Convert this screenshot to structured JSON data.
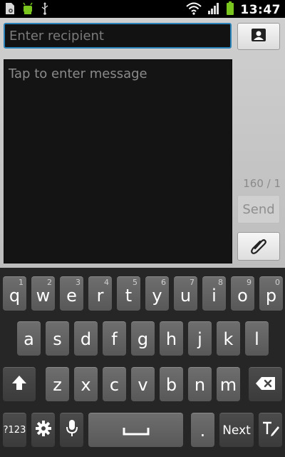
{
  "status_bar": {
    "time": "13:47",
    "left_icons": [
      "settings-file-icon",
      "android-icon",
      "usb-icon"
    ],
    "right_icons": [
      "wifi-icon",
      "signal-icon",
      "battery-icon"
    ]
  },
  "compose": {
    "recipient_placeholder": "Enter recipient",
    "message_placeholder": "Tap to enter message",
    "counter": "160 / 1",
    "send_label": "Send"
  },
  "keyboard": {
    "row1": [
      {
        "label": "q",
        "hint": "1"
      },
      {
        "label": "w",
        "hint": "2"
      },
      {
        "label": "e",
        "hint": "3"
      },
      {
        "label": "r",
        "hint": "4"
      },
      {
        "label": "t",
        "hint": "5"
      },
      {
        "label": "y",
        "hint": "6"
      },
      {
        "label": "u",
        "hint": "7"
      },
      {
        "label": "i",
        "hint": "8"
      },
      {
        "label": "o",
        "hint": "9"
      },
      {
        "label": "p",
        "hint": "0"
      }
    ],
    "row2": [
      "a",
      "s",
      "d",
      "f",
      "g",
      "h",
      "j",
      "k",
      "l"
    ],
    "row3": [
      "z",
      "x",
      "c",
      "v",
      "b",
      "n",
      "m"
    ],
    "symbols_label": "?123",
    "period_label": ".",
    "next_label": "Next"
  }
}
